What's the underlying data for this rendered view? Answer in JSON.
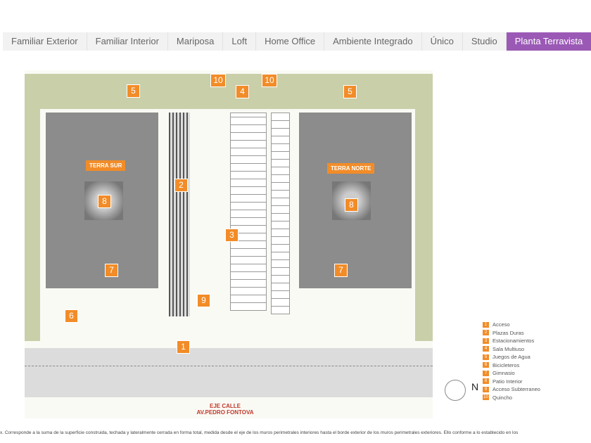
{
  "tabs": [
    {
      "label": "Familiar Exterior",
      "active": false
    },
    {
      "label": "Familiar Interior",
      "active": false
    },
    {
      "label": "Mariposa",
      "active": false
    },
    {
      "label": "Loft",
      "active": false
    },
    {
      "label": "Home Office",
      "active": false
    },
    {
      "label": "Ambiente Integrado",
      "active": false
    },
    {
      "label": "Único",
      "active": false
    },
    {
      "label": "Studio",
      "active": false
    },
    {
      "label": "Planta Terravista",
      "active": true
    }
  ],
  "plan": {
    "building_south": "TERRA SUR",
    "building_north": "TERRA NORTE",
    "street_axis": "EJE CALLE",
    "street_name": "AV.PEDRO FONTOVA",
    "north": "N",
    "markers": [
      "1",
      "2",
      "3",
      "4",
      "5",
      "5",
      "6",
      "7",
      "7",
      "8",
      "8",
      "9",
      "10",
      "10"
    ]
  },
  "legend": [
    {
      "n": "1",
      "label": "Acceso"
    },
    {
      "n": "2",
      "label": "Plazas Duras"
    },
    {
      "n": "3",
      "label": "Estacionamientos"
    },
    {
      "n": "4",
      "label": "Sala Multiuso"
    },
    {
      "n": "5",
      "label": "Juegos de Agua"
    },
    {
      "n": "6",
      "label": "Bicicleteros"
    },
    {
      "n": "7",
      "label": "Gimnasio"
    },
    {
      "n": "8",
      "label": "Patio Interior"
    },
    {
      "n": "9",
      "label": "Acceso Subterraneo"
    },
    {
      "n": "10",
      "label": "Quincho"
    }
  ],
  "footnote": "x. Corresponde a la suma de la superficie construida, techada y lateralmente cerrada en forma total, medida desde el eje de los muros perimetrales interiores hasta el borde exterior de los muros perimetrales exteriores. Ello conforme a lo establecido en los"
}
